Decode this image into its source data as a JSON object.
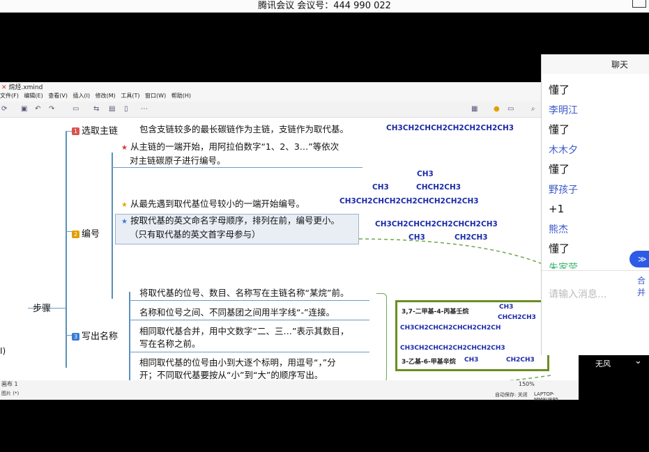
{
  "meeting_bar": {
    "title": "腾讯会议 会议号：444 990 022"
  },
  "app": {
    "title": "烷烃.xmind",
    "menus": [
      "文件(F)",
      "编辑(E)",
      "查看(V)",
      "插入(I)",
      "修改(M)",
      "工具(T)",
      "窗口(W)",
      "帮助(H)"
    ],
    "tab": "烷烃",
    "status_left": "画布 1",
    "status_left2": "图片 (*)",
    "zoom": "150%",
    "autosave": "自动保存: 关闭",
    "machine": "LAPTOP-MM9URP5"
  },
  "mindmap": {
    "root": "步骤",
    "left_partial": "I)",
    "step1": {
      "num": "1",
      "label": "选取主链",
      "text": "包含支链较多的最长碳链作为主链，支链作为取代基。"
    },
    "step2": {
      "num": "2",
      "label": "编号",
      "rule1_line1": "从主链的一端开始，用阿拉伯数字“1、2、3…”等依次",
      "rule1_line2": "对主链碳原子进行编号。",
      "rule2": "从最先遇到取代基位号较小的一端开始编号。",
      "rule3_line1": "按取代基的英文命名字母顺序，排列在前，编号更小。",
      "rule3_line2": "（只有取代基的英文首字母参与）"
    },
    "step3": {
      "num": "3",
      "label": "写出名称",
      "rule1": "将取代基的位号、数目、名称写在主链名称“某烷”前。",
      "rule2": "名称和位号之间、不同基团之间用半字线“-”连接。",
      "rule3_line1": "相同取代基合并，用中文数字“二、三…”表示其数目，",
      "rule3_line2": "写在名称之前。",
      "rule4_line1": "相同取代基的位号由小到大逐个标明，用逗号“，”分",
      "rule4_line2": "开；不同取代基要按从“小”到“大”的顺序写出。"
    },
    "formulas": {
      "f0": "CH3CH2CHCH2CH2CH2CH2CH3",
      "f1_main": "CH3CH2CHCH2CH2CHCH2CH2CH3",
      "f1_top1": "CH3",
      "f1_top2": "CHCH2CH3",
      "f1_top3": "CH3",
      "f2_main": "CH3CH2CHCH2CH2CHCH2CH3",
      "f2_bot1": "CH3",
      "f2_bot2": "CH2CH3",
      "box_name1": "3,7-二甲基-4-丙基壬烷",
      "box_name2": "3-乙基-6-甲基辛烷",
      "box_f1": "CH3CH2CHCH2CHCH2CH2CH",
      "box_f2": "CH3CH2CHCH2CH2CHCH2CH3",
      "box_sub1": "CH3",
      "box_sub2": "CHCH2CH3",
      "box_sub3": "CH3",
      "box_sub4": "CH2CH3"
    }
  },
  "chat": {
    "title": "聊天",
    "messages": [
      {
        "type": "msg",
        "text": "懂了"
      },
      {
        "type": "user",
        "text": "李明江"
      },
      {
        "type": "msg",
        "text": "懂了"
      },
      {
        "type": "user",
        "text": "木木夕"
      },
      {
        "type": "msg",
        "text": "懂了"
      },
      {
        "type": "user",
        "text": "野孩子"
      },
      {
        "type": "msg",
        "text": "+1"
      },
      {
        "type": "user",
        "text": "熊杰"
      },
      {
        "type": "msg",
        "text": "懂了"
      }
    ],
    "partial_user": "朱家莹",
    "input_placeholder": "请输入消息...",
    "merge_label": "合并",
    "unread_glyph": "≫"
  },
  "overlay": {
    "wind_label": "无风"
  }
}
